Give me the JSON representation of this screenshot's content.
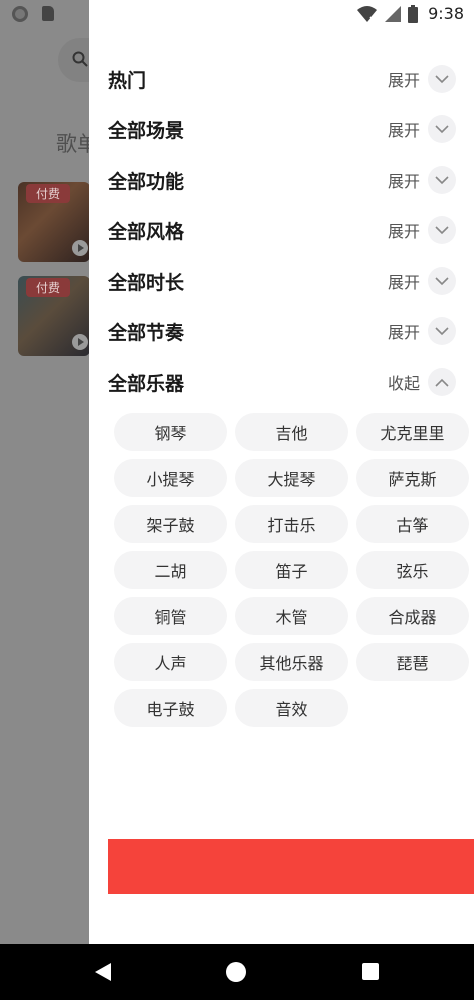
{
  "status_bar": {
    "time": "9:38"
  },
  "background": {
    "heading": "歌单",
    "cards": [
      {
        "badge": "付费"
      },
      {
        "badge": "付费"
      }
    ]
  },
  "drawer": {
    "filters": [
      {
        "title": "热门",
        "toggle": "展开",
        "expanded": false
      },
      {
        "title": "全部场景",
        "toggle": "展开",
        "expanded": false
      },
      {
        "title": "全部功能",
        "toggle": "展开",
        "expanded": false
      },
      {
        "title": "全部风格",
        "toggle": "展开",
        "expanded": false
      },
      {
        "title": "全部时长",
        "toggle": "展开",
        "expanded": false
      },
      {
        "title": "全部节奏",
        "toggle": "展开",
        "expanded": false
      },
      {
        "title": "全部乐器",
        "toggle": "收起",
        "expanded": true
      }
    ],
    "instrument_chips": [
      "钢琴",
      "吉他",
      "尤克里里",
      "小提琴",
      "大提琴",
      "萨克斯",
      "架子鼓",
      "打击乐",
      "古筝",
      "二胡",
      "笛子",
      "弦乐",
      "铜管",
      "木管",
      "合成器",
      "人声",
      "其他乐器",
      "琵琶",
      "电子鼓",
      "音效"
    ]
  },
  "colors": {
    "accent": "#f5433b",
    "overlay": "#8a8a8a",
    "chip_bg": "#f4f4f5"
  }
}
